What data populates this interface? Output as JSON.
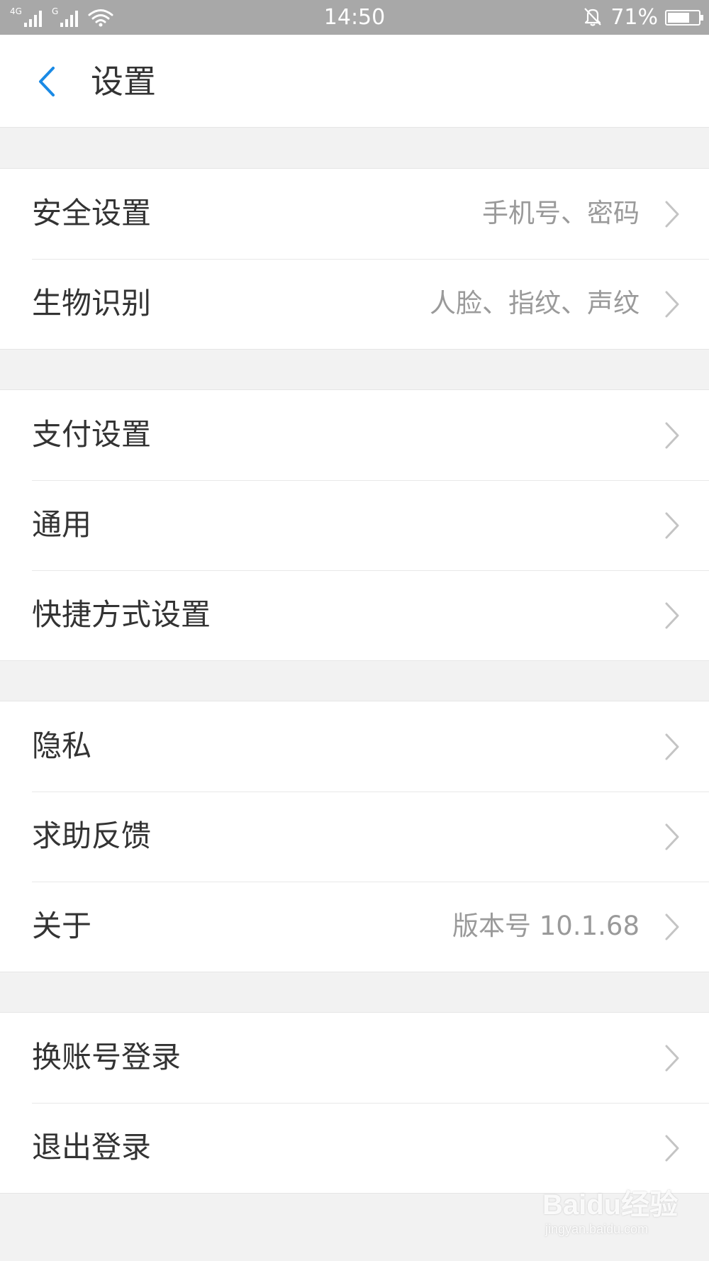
{
  "status_bar": {
    "network_1": "4G",
    "network_2": "G",
    "time": "14:50",
    "battery_percent": "71%",
    "battery_level": 0.71,
    "icons": [
      "signal-icon",
      "signal-icon",
      "wifi-icon",
      "bell-muted-icon",
      "battery-icon"
    ]
  },
  "header": {
    "back_icon": "chevron-left-icon",
    "title": "设置",
    "accent_color": "#1a8ae5"
  },
  "groups": [
    {
      "items": [
        {
          "label": "安全设置",
          "value": "手机号、密码"
        },
        {
          "label": "生物识别",
          "value": "人脸、指纹、声纹"
        }
      ]
    },
    {
      "items": [
        {
          "label": "支付设置",
          "value": ""
        },
        {
          "label": "通用",
          "value": ""
        },
        {
          "label": "快捷方式设置",
          "value": ""
        }
      ]
    },
    {
      "items": [
        {
          "label": "隐私",
          "value": ""
        },
        {
          "label": "求助反馈",
          "value": ""
        },
        {
          "label": "关于",
          "value": "版本号 10.1.68"
        }
      ]
    },
    {
      "items": [
        {
          "label": "换账号登录",
          "value": ""
        },
        {
          "label": "退出登录",
          "value": ""
        }
      ]
    }
  ],
  "watermark": {
    "main": "Baidu经验",
    "sub": "jingyan.baidu.com"
  }
}
